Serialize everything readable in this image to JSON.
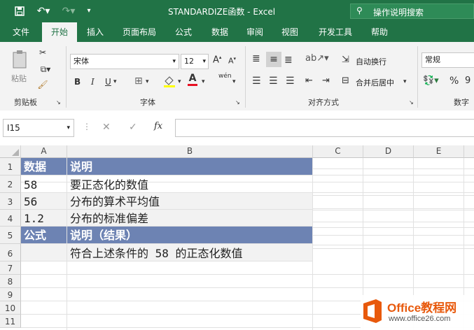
{
  "titlebar": {
    "title": "STANDARDIZE函数  -  Excel",
    "search_placeholder": "操作说明搜索"
  },
  "tabs": [
    "文件",
    "开始",
    "插入",
    "页面布局",
    "公式",
    "数据",
    "审阅",
    "视图",
    "开发工具",
    "帮助"
  ],
  "ribbon": {
    "clipboard": {
      "paste": "粘贴",
      "label": "剪贴板"
    },
    "font": {
      "name": "宋体",
      "size": "12",
      "label": "字体",
      "bold": "B",
      "italic": "I",
      "underline": "U",
      "grow": "A",
      "shrink": "A",
      "font_color_letter": "A",
      "phonetic": "wén"
    },
    "align": {
      "wrap": "自动换行",
      "merge": "合并后居中",
      "label": "对齐方式"
    },
    "number": {
      "format": "常规",
      "label": "数字",
      "percent": "%"
    }
  },
  "formula_bar": {
    "name_box": "I15",
    "fx": "fx",
    "value": ""
  },
  "columns": [
    "A",
    "B",
    "C",
    "D",
    "E"
  ],
  "rows": [
    "1",
    "2",
    "3",
    "4",
    "5",
    "6",
    "7",
    "8",
    "9",
    "10",
    "11"
  ],
  "cells": {
    "r1": {
      "a": "数据",
      "b": "说明"
    },
    "r2": {
      "a": "58",
      "b": "要正态化的数值"
    },
    "r3": {
      "a": "56",
      "b": "分布的算术平均值"
    },
    "r4": {
      "a": "1.2",
      "b": "分布的标准偏差"
    },
    "r5": {
      "a": "公式",
      "b": "说明（结果）"
    },
    "r6": {
      "a": "",
      "b": "符合上述条件的 58 的正态化数值"
    }
  },
  "watermark": {
    "brand": "Office教程网",
    "url": "www.office26.com"
  },
  "colors": {
    "excel_green": "#217346",
    "header_fill": "#6d83b3",
    "watermark_orange": "#e8590c"
  }
}
